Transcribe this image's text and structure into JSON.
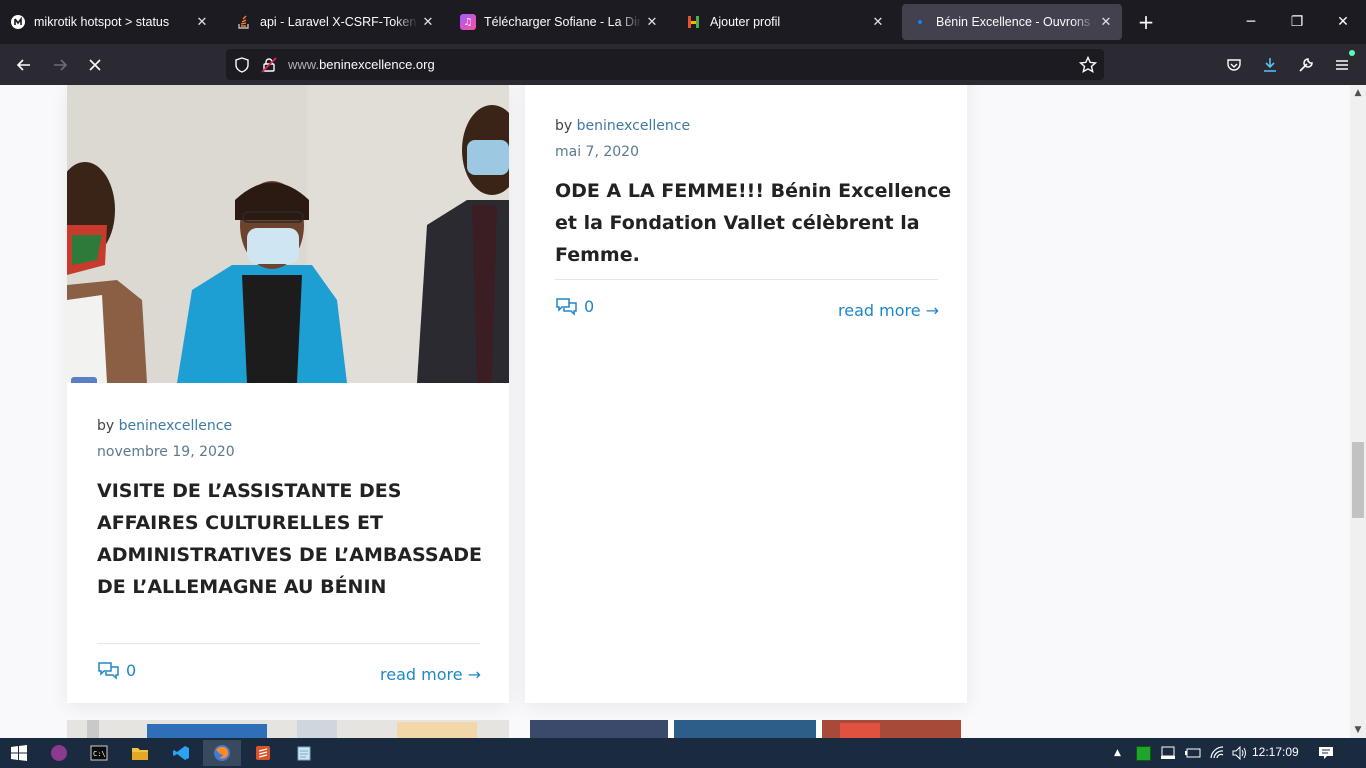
{
  "browser": {
    "tabs": [
      {
        "title": "mikrotik hotspot > status",
        "icon": "mikrotik-favicon",
        "active": false
      },
      {
        "title": "api - Laravel X-CSRF-Token mismatch",
        "icon": "stackoverflow-favicon",
        "active": false
      },
      {
        "title": "Télécharger Sofiane - La Direction",
        "icon": "music-favicon",
        "active": false
      },
      {
        "title": "Ajouter profil",
        "icon": "hotspot-favicon",
        "active": false
      },
      {
        "title": "Bénin Excellence - Ouvrons des",
        "icon": "loading-favicon",
        "active": true
      }
    ],
    "new_tab_label": "+",
    "url_domain": "www.",
    "url_rest": "beninexcellence.org",
    "window_controls": {
      "minimize": "─",
      "restore": "❐",
      "close": "✕"
    }
  },
  "posts": [
    {
      "author_prefix": "by",
      "author": "beninexcellence",
      "date": "novembre 19, 2020",
      "title": "VISITE DE L’ASSISTANTE DES AFFAIRES CULTURELLES ET ADMINISTRATIVES DE L’AMBASSADE DE L’ALLEMAGNE AU BÉNIN",
      "comments": "0",
      "read_more": "read more →"
    },
    {
      "author_prefix": "by",
      "author": "beninexcellence",
      "date": "mai 7, 2020",
      "title": "ODE A LA FEMME!!! Bénin Excellence et la Fondation Vallet célèbrent la Femme.",
      "comments": "0",
      "read_more": "read more →"
    }
  ],
  "taskbar": {
    "clock": "12:17:09",
    "apps": [
      "windows-start",
      "app-purple",
      "terminal",
      "file-explorer",
      "vscode",
      "firefox",
      "sublime-text",
      "notepad"
    ]
  },
  "colors": {
    "link": "#1e87c8",
    "tab_bar": "#1c1b22",
    "nav_bar": "#2b2a33",
    "taskbar": "#1a2a3f"
  }
}
